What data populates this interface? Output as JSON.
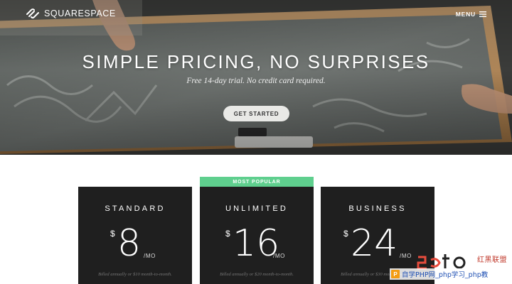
{
  "header": {
    "logo_text": "SQUARESPACE",
    "menu_label": "MENU"
  },
  "hero": {
    "title": "SIMPLE PRICING, NO SURPRISES",
    "subtitle": "Free 14-day trial. No credit card required.",
    "cta_label": "GET STARTED"
  },
  "pricing": {
    "badge": "MOST POPULAR",
    "plans": [
      {
        "name": "STANDARD",
        "currency": "$",
        "amount": "8",
        "period": "/MO",
        "billing": "Billed annually or $10 month-to-month."
      },
      {
        "name": "UNLIMITED",
        "currency": "$",
        "amount": "16",
        "period": "/MO",
        "billing": "Billed annually or $20 month-to-month."
      },
      {
        "name": "BUSINESS",
        "currency": "$",
        "amount": "24",
        "period": "/MO",
        "billing": "Billed annually or $30 month-to-month."
      }
    ]
  },
  "watermark": {
    "brand_cn": "红黑联盟",
    "bar_mark": "P",
    "bar_text": "自学PHP网_php学习_php教"
  },
  "colors": {
    "accent_badge": "#5fcf8e",
    "card_bg": "#1f1f1f",
    "cta_bg": "#e9e9e6"
  },
  "icons": {
    "logo": "squarespace-logo-icon",
    "menu": "hamburger-menu-icon"
  }
}
